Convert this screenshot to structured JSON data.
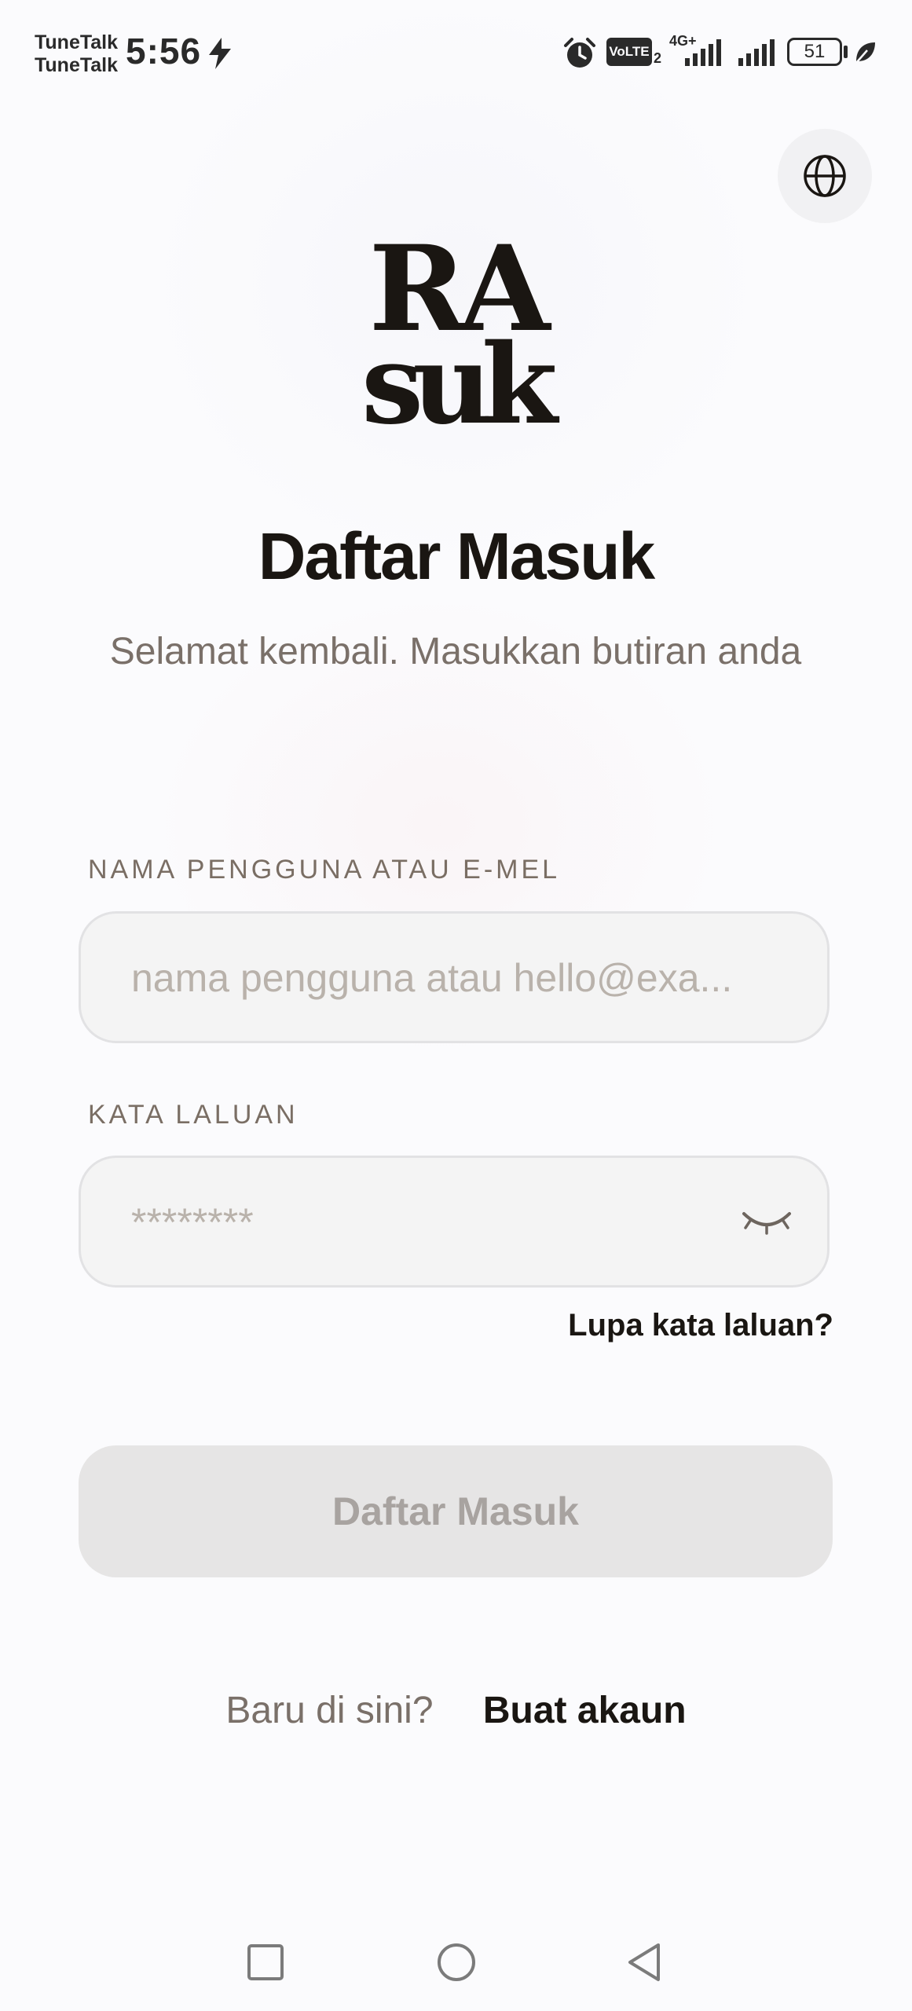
{
  "status_bar": {
    "carrier_1": "TuneTalk",
    "carrier_2": "TuneTalk",
    "time": "5:56",
    "volte_label": "VoLTE",
    "sim_slot": "2",
    "network_type": "4G+",
    "battery_level": "51"
  },
  "header": {
    "language_icon": "globe-icon",
    "logo_line_1": "RA",
    "logo_line_2": "suk"
  },
  "main": {
    "title": "Daftar Masuk",
    "subtitle": "Selamat kembali. Masukkan butiran anda"
  },
  "form": {
    "username_label": "NAMA PENGGUNA ATAU E-MEL",
    "username_placeholder": "nama pengguna atau hello@exa...",
    "username_value": "",
    "password_label": "KATA LALUAN",
    "password_placeholder": "********",
    "password_value": "",
    "password_toggle_icon": "eye-closed-icon",
    "forgot_password": "Lupa kata laluan?",
    "submit_label": "Daftar Masuk"
  },
  "signup": {
    "prompt": "Baru di sini?",
    "link": "Buat akaun"
  },
  "nav_bar": {
    "recents_icon": "square-icon",
    "home_icon": "circle-icon",
    "back_icon": "triangle-back-icon"
  },
  "colors": {
    "primary_text": "#1a1612",
    "muted_text": "#7a7069",
    "input_bg": "#f4f4f4",
    "button_disabled_bg": "#e6e5e5",
    "button_disabled_text": "#a8a3a0"
  }
}
